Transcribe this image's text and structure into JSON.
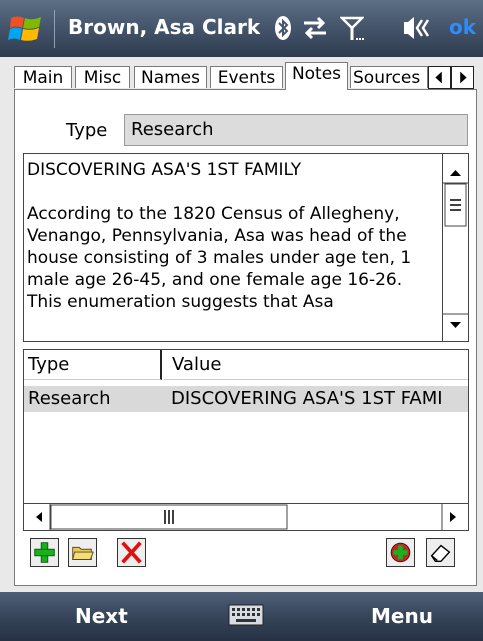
{
  "titlebar": {
    "title": "Brown, Asa Clark",
    "ok_label": "ok",
    "icons": [
      "windows-flag-icon",
      "bluetooth-icon",
      "sync-arrows-icon",
      "signal-icon",
      "volume-icon"
    ]
  },
  "tabs": [
    {
      "label": "Main"
    },
    {
      "label": "Misc"
    },
    {
      "label": "Names"
    },
    {
      "label": "Events"
    },
    {
      "label": "Notes",
      "active": true
    },
    {
      "label": "Sources"
    }
  ],
  "type_field": {
    "label": "Type",
    "value": "Research"
  },
  "note": {
    "heading": "DISCOVERING ASA'S 1ST FAMILY",
    "body": "According to the 1820 Census of Allegheny, Venango, Pennsylvania, Asa was head of the house consisting of 3 males under age ten, 1 male age 26-45, and one female age 16-26.  This enumeration suggests that Asa"
  },
  "list": {
    "columns": [
      "Type",
      "Value"
    ],
    "rows": [
      {
        "type": "Research",
        "value": "DISCOVERING ASA'S 1ST FAMI"
      }
    ]
  },
  "toolbar": {
    "buttons": [
      "add-icon",
      "open-folder-icon",
      "delete-icon",
      "add-source-icon",
      "eraser-icon"
    ]
  },
  "softkeys": {
    "left": "Next",
    "right": "Menu",
    "center_icon": "keyboard-icon"
  },
  "colors": {
    "titlebar": "#46566c",
    "ok": "#2d8cff",
    "selected_row": "#d9d9d9",
    "add_green": "#19b21d",
    "delete_red": "#e01010"
  }
}
